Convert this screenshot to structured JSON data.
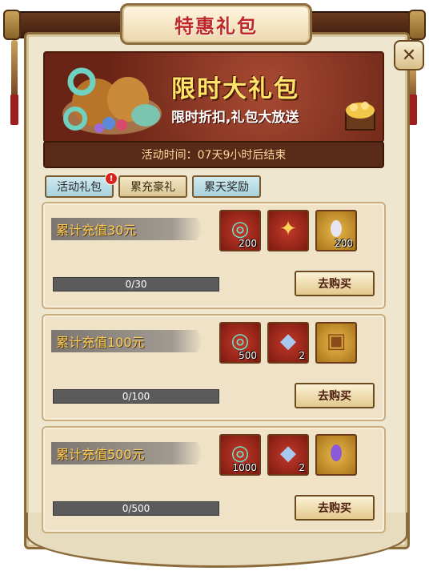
{
  "title": "特惠礼包",
  "close_label": "✕",
  "banner": {
    "title": "限时大礼包",
    "subtitle": "限时折扣,礼包大放送",
    "time": "活动时间：07天9小时后结束"
  },
  "tabs": [
    {
      "label": "活动礼包",
      "active": true,
      "badge": "!"
    },
    {
      "label": "累充豪礼",
      "active": false
    },
    {
      "label": "累天奖励",
      "active": false
    }
  ],
  "tiers": [
    {
      "title": "累计充值30元",
      "progress": "0/30",
      "progress_fraction": 0,
      "buy_label": "去购买",
      "items": [
        {
          "icon": "jade-dragon-icon",
          "glyph": "◎",
          "count": "200",
          "bg": "red"
        },
        {
          "icon": "golden-feather-icon",
          "glyph": "✦",
          "count": "",
          "bg": "red"
        },
        {
          "icon": "spotted-egg-icon",
          "glyph": "⬮",
          "count": "200",
          "bg": "gold"
        }
      ]
    },
    {
      "title": "累计充值100元",
      "progress": "0/100",
      "progress_fraction": 0,
      "buy_label": "去购买",
      "items": [
        {
          "icon": "jade-dragon-icon",
          "glyph": "◎",
          "count": "500",
          "bg": "red"
        },
        {
          "icon": "crystal-skull-icon",
          "glyph": "◆",
          "count": "2",
          "bg": "red"
        },
        {
          "icon": "ornate-frame-icon",
          "glyph": "▣",
          "count": "",
          "bg": "gold"
        }
      ]
    },
    {
      "title": "累计充值500元",
      "progress": "0/500",
      "progress_fraction": 0,
      "buy_label": "去购买",
      "items": [
        {
          "icon": "jade-dragon-icon",
          "glyph": "◎",
          "count": "1000",
          "bg": "red"
        },
        {
          "icon": "crystal-skull-icon",
          "glyph": "◆",
          "count": "2",
          "bg": "red"
        },
        {
          "icon": "purple-dragon-egg-icon",
          "glyph": "⬮",
          "count": "",
          "bg": "gold"
        }
      ]
    }
  ],
  "colors": {
    "accent_title": "#c0292a",
    "banner_title": "#ffe36a",
    "ribbon_text": "#ffcd52"
  }
}
